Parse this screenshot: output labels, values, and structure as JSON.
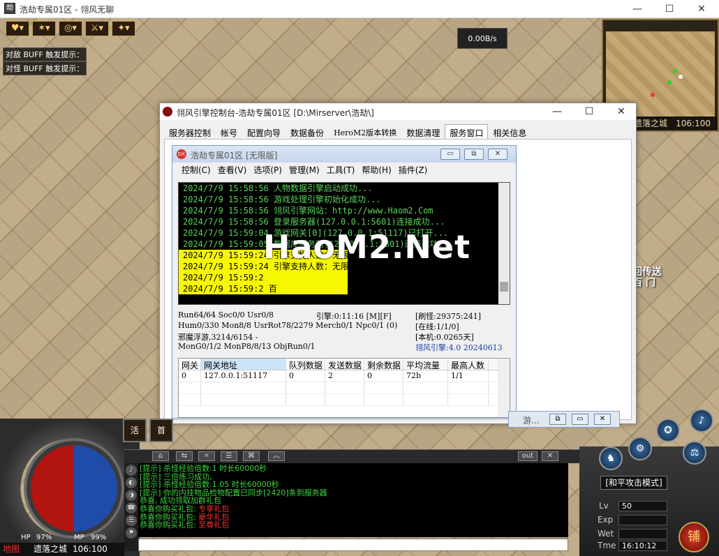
{
  "window": {
    "title": "浩劫专属01区 - 翎风无聊",
    "controls": {
      "minimize": "—",
      "maximize": "☐",
      "close": "✕"
    }
  },
  "game": {
    "buff_icons": [
      "heart-icon",
      "claw-icon",
      "swirl-icon",
      "sword-icon",
      "gem-icon"
    ],
    "buff_hints": [
      "对敌 BUFF 触发提示：",
      "对怪 BUFF 触发提示："
    ],
    "net_speed": "0.00B/s",
    "minimap_location": "遗落之城",
    "minimap_coords": "106:100",
    "side_map_text": "落之城",
    "ghost_sign": "回传送\n百 门"
  },
  "console": {
    "title": "翎风引擎控制台-浩劫专属01区 [D:\\Mirserver\\浩劫\\]",
    "tabs": [
      "服务器控制",
      "帐号",
      "配置向导",
      "数据备份",
      "HeroM2版本转换",
      "数据清理",
      "服务窗口",
      "相关信息"
    ],
    "active_tab": 6,
    "inner": {
      "title": "浩劫专属01区 [无限版]",
      "icon_text": "DX",
      "buttons": {
        "minimize": "▭",
        "restore": "⧉",
        "close": "✕"
      },
      "menu": [
        "控制(C)",
        "查看(V)",
        "选项(P)",
        "管理(M)",
        "工具(T)",
        "帮助(H)",
        "插件(Z)"
      ],
      "log": [
        {
          "text": "2024/7/9 15:58:56 人物数据引擎启动成功...",
          "hl": false
        },
        {
          "text": "2024/7/9 15:58:56 游戏处理引擎初始化成功...",
          "hl": false
        },
        {
          "text": "2024/7/9 15:58:56 翎风引擎网站：http://www.Haom2.Com",
          "hl": false
        },
        {
          "text": "2024/7/9 15:58:56 登录服务器(127.0.0.1:5601)连接成功...",
          "hl": false
        },
        {
          "text": "2024/7/9 15:59:04 游戏网关[0](127.0.0.1:51117)已打开...",
          "hl": false
        },
        {
          "text": "2024/7/9 15:59:05 数据库服务器(127.0.0.1:5801)连接成功...",
          "hl": false
        },
        {
          "text": "2024/7/9 15:59:24 引擎支持人数：无限",
          "hl": true
        },
        {
          "text": "2024/7/9 15:59:24 引擎支持人数：无限",
          "hl": true
        },
        {
          "text": "2024/7/9 15:59:2",
          "hl": true
        },
        {
          "text": "2024/7/9 15:59:2 百",
          "hl": true
        }
      ],
      "watermark": "HaoM2.Net",
      "stats": {
        "r1a": "Run64/64 Soc0/0 Usr0/8",
        "r1b": "引擎:0:11:16 [M][F]",
        "r1c": "[刷怪:29375:241]",
        "r2a": "Hum0/330 Mon8/8 UsrRot78/2279 Merch0/1 Npc0/1 (0)",
        "r2c": "[在线:1/1/0]",
        "r3a": "邪魔浮游,3214/6154 -",
        "r3c": "[本机:0.0265天]",
        "r4a": "MonG0/1/2 MonP8/8/13 ObjRun0/1",
        "r4c": "翎风引擎:4.0 20240613"
      },
      "table": {
        "headers": [
          "网关",
          "网关地址",
          "队列数据",
          "发送数据",
          "剩余数据",
          "平均流量",
          "最高人数"
        ],
        "rows": [
          [
            "0",
            "127.0.0.1:51117",
            "0",
            "2",
            "0",
            "72b",
            "1/1"
          ]
        ]
      },
      "minimized_label": "游..."
    }
  },
  "hud": {
    "skill_labels": [
      "活",
      "首"
    ],
    "chat_buttons": [
      "out",
      "✕"
    ],
    "chat_side": [
      "♪",
      "◐",
      "◑",
      "☎",
      "☰",
      "⚑",
      "◉",
      "◎"
    ],
    "chat": [
      {
        "text": "[提示] 杀怪经验倍数:1 时长60000秒",
        "color": "#3fd43f",
        "suffix": "",
        "suffix_color": ""
      },
      {
        "text": "[提示] 三倍练习成功,",
        "color": "#3fd43f",
        "suffix": "",
        "suffix_color": ""
      },
      {
        "text": "[提示] 杀怪经验倍数:1.05 时长60000秒",
        "color": "#3fd43f",
        "suffix": "",
        "suffix_color": ""
      },
      {
        "text": "[提示] 你的内挂物品检物配置已同步[2420]条到服务器",
        "color": "#3fd43f",
        "suffix": "",
        "suffix_color": ""
      },
      {
        "text": "恭喜, 成功领取加群礼包",
        "color": "#3fd43f",
        "suffix": "",
        "suffix_color": ""
      },
      {
        "text": "恭喜你购买礼包: ",
        "color": "#3fd43f",
        "suffix": "专享礼包",
        "suffix_color": "#ff3030"
      },
      {
        "text": "恭喜你购买礼包: ",
        "color": "#3fd43f",
        "suffix": "豪华礼包",
        "suffix_color": "#ff3030"
      },
      {
        "text": "恭喜你购买礼包: ",
        "color": "#3fd43f",
        "suffix": "至尊礼包",
        "suffix_color": "#ff3030"
      }
    ],
    "mode": "[和平攻击模式]",
    "level_label": "Lv",
    "level": "50",
    "exp_label": "Exp",
    "weight_label": "Wet",
    "time_label": "Tme",
    "time": "16:10:12",
    "shop": "铺",
    "hp_label": "HP",
    "hp": "97%",
    "mp_label": "MP",
    "mp": "99%",
    "map_label": "地图",
    "location": "遗落之城",
    "coords": "106:100"
  },
  "colors": {
    "log_green": "#5bd35b",
    "highlight": "#f7f700",
    "console_icon": "#8b0a0a"
  }
}
